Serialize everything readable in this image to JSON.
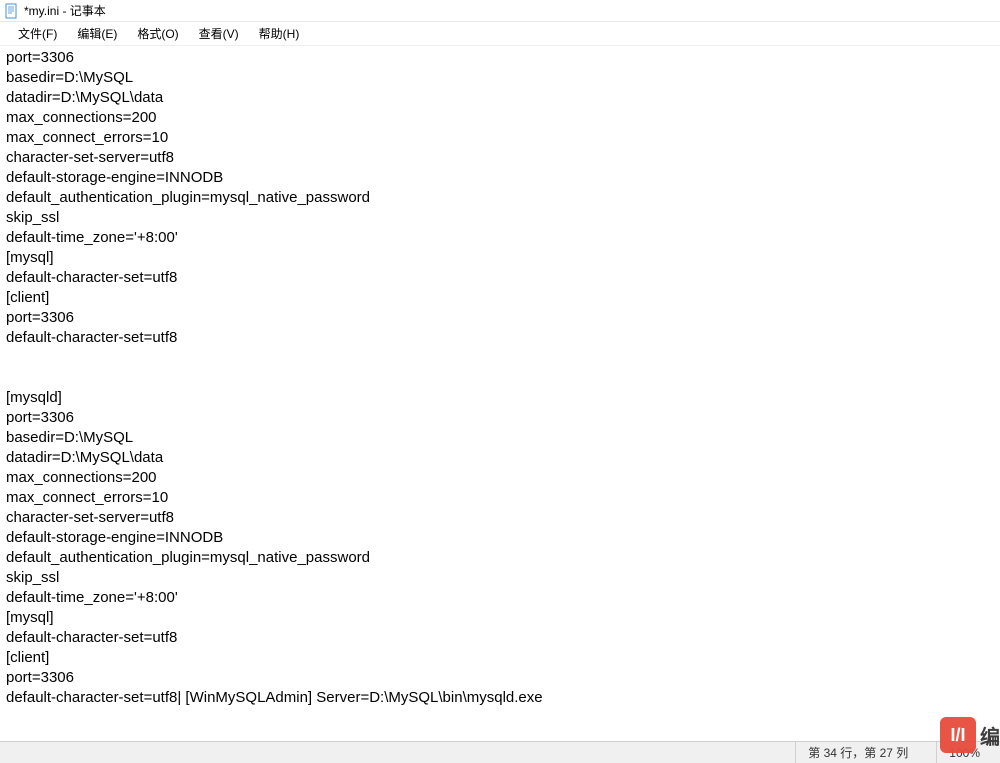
{
  "titlebar": {
    "title": "*my.ini - 记事本"
  },
  "menubar": {
    "items": [
      "文件(F)",
      "编辑(E)",
      "格式(O)",
      "查看(V)",
      "帮助(H)"
    ]
  },
  "content": {
    "lines": [
      "port=3306",
      "basedir=D:\\MySQL",
      "datadir=D:\\MySQL\\data",
      "max_connections=200",
      "max_connect_errors=10",
      "character-set-server=utf8",
      "default-storage-engine=INNODB",
      "default_authentication_plugin=mysql_native_password",
      "skip_ssl",
      "default-time_zone='+8:00'",
      "[mysql]",
      "default-character-set=utf8",
      "[client]",
      "port=3306",
      "default-character-set=utf8",
      "",
      "",
      "[mysqld]",
      "port=3306",
      "basedir=D:\\MySQL",
      "datadir=D:\\MySQL\\data",
      "max_connections=200",
      "max_connect_errors=10",
      "character-set-server=utf8",
      "default-storage-engine=INNODB",
      "default_authentication_plugin=mysql_native_password",
      "skip_ssl",
      "default-time_zone='+8:00'",
      "[mysql]",
      "default-character-set=utf8",
      "[client]",
      "port=3306",
      "default-character-set=utf8| [WinMySQLAdmin] Server=D:\\MySQL\\bin\\mysqld.exe"
    ]
  },
  "statusbar": {
    "position": "第 34 行，第 27 列",
    "zoom": "100%"
  },
  "watermark": {
    "logo_text": "I/I",
    "brand": "编"
  }
}
